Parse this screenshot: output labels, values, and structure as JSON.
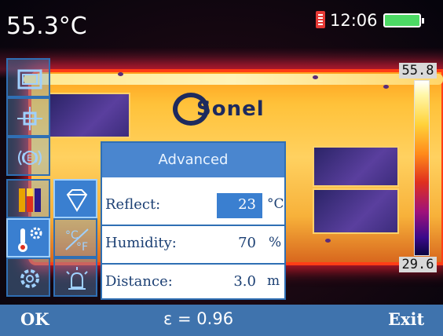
{
  "status": {
    "temperature": "55.3°C",
    "time": "12:06",
    "icons": [
      "sd-card-icon",
      "battery-icon"
    ]
  },
  "thermal_image": {
    "brand_logo_text": "Sonel"
  },
  "color_scale": {
    "max": "55.8",
    "min": "29.6"
  },
  "toolbar": {
    "items": [
      {
        "icon": "frame-icon"
      },
      {
        "icon": "crosshair-icon"
      },
      {
        "icon": "emissivity-icon"
      },
      {
        "icon": "palette-icon"
      },
      {
        "icon": "thermometer-settings-icon",
        "selected": true
      },
      {
        "icon": "gear-icon"
      }
    ],
    "subitems": [
      {
        "icon": "diamond-icon",
        "selected": true
      },
      {
        "icon": "celsius-fahrenheit-icon"
      },
      {
        "icon": "alarm-icon"
      }
    ]
  },
  "panel": {
    "title": "Advanced",
    "rows": [
      {
        "label": "Reflect:",
        "value": "23",
        "unit": "°C"
      },
      {
        "label": "Humidity:",
        "value": "70",
        "unit": "%"
      },
      {
        "label": "Distance:",
        "value": "3.0",
        "unit": "m"
      }
    ]
  },
  "bottom_bar": {
    "ok": "OK",
    "emissivity": "ε = 0.96",
    "exit": "Exit"
  },
  "colors": {
    "accent": "#3a7fd0",
    "bar": "#3f73ad",
    "panel_text": "#1b3f73"
  }
}
